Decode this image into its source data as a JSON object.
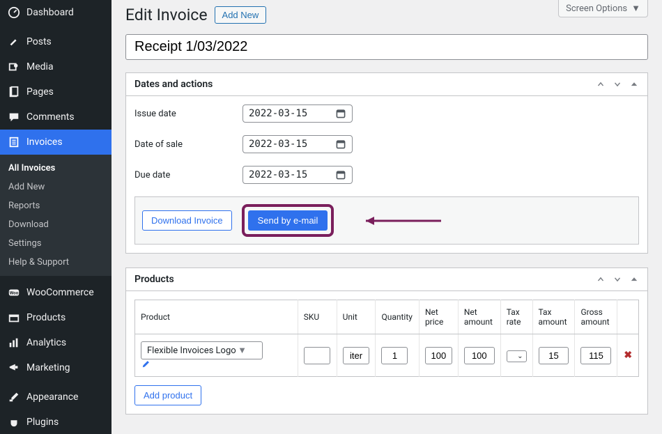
{
  "screen_options_label": "Screen Options",
  "page_title": "Edit Invoice",
  "add_new_label": "Add New",
  "title_value": "Receipt 1/03/2022",
  "sidebar": {
    "dashboard": "Dashboard",
    "posts": "Posts",
    "media": "Media",
    "pages": "Pages",
    "comments": "Comments",
    "invoices": "Invoices",
    "woocommerce": "WooCommerce",
    "products": "Products",
    "analytics": "Analytics",
    "marketing": "Marketing",
    "appearance": "Appearance",
    "plugins": "Plugins"
  },
  "submenu": {
    "all_invoices": "All Invoices",
    "add_new": "Add New",
    "reports": "Reports",
    "download": "Download",
    "settings": "Settings",
    "help": "Help & Support"
  },
  "dates_box": {
    "title": "Dates and actions",
    "issue_label": "Issue date",
    "issue_value": "2022-03-15",
    "sale_label": "Date of sale",
    "sale_value": "2022-03-15",
    "due_label": "Due date",
    "due_value": "2022-03-15",
    "download_btn": "Download Invoice",
    "send_btn": "Send by e-mail"
  },
  "products_box": {
    "title": "Products",
    "headers": {
      "product": "Product",
      "sku": "SKU",
      "unit": "Unit",
      "qty": "Quantity",
      "net_price": "Net price",
      "net_amount": "Net amount",
      "tax_rate": "Tax rate",
      "tax_amount": "Tax amount",
      "gross": "Gross amount"
    },
    "row": {
      "product": "Flexible Invoices Logo",
      "sku": "",
      "unit": "iter",
      "qty": "1",
      "net_price": "100",
      "net_amount": "100",
      "tax_rate": "",
      "tax_amount": "15",
      "gross": "115"
    },
    "add_product": "Add product"
  }
}
